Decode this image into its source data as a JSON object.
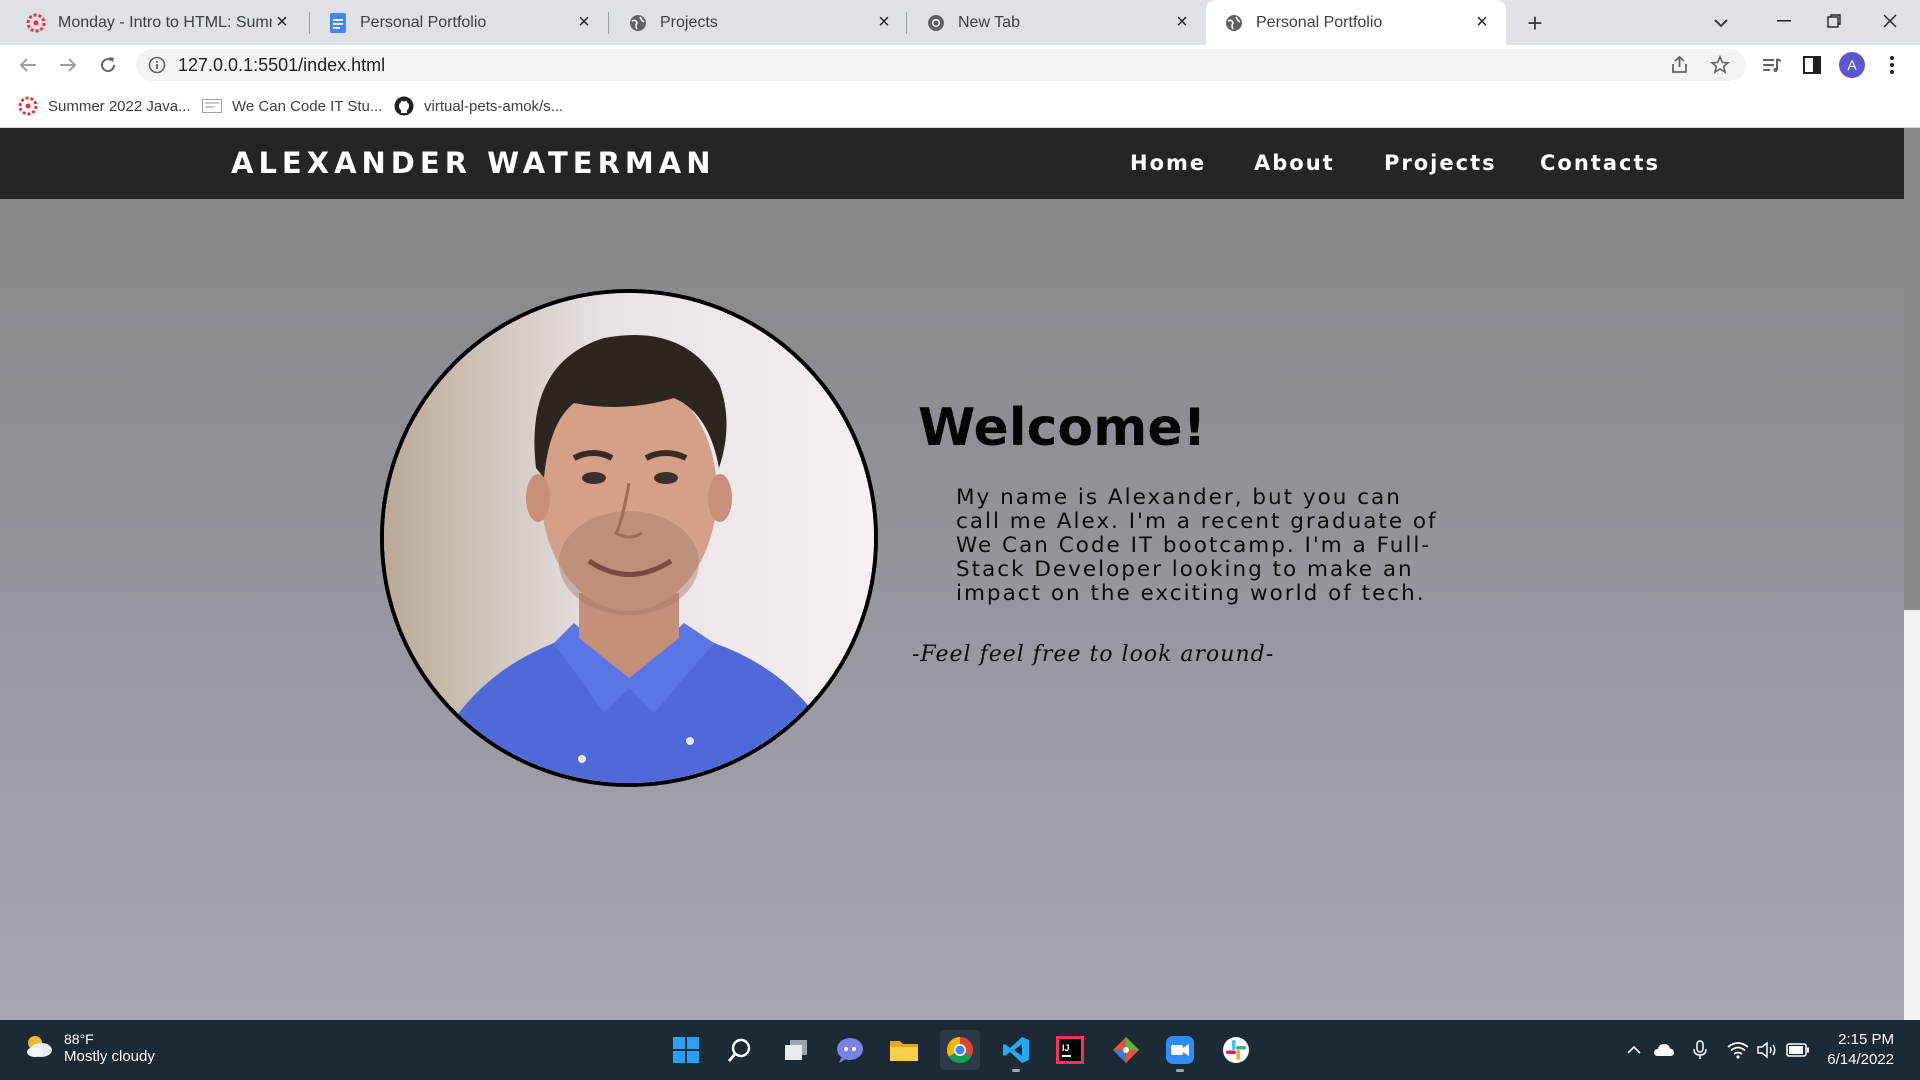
{
  "browser": {
    "tabs": [
      {
        "label": "Monday - Intro to HTML: Summe",
        "icon": "canvas-icon",
        "active": false
      },
      {
        "label": "Personal Portfolio",
        "icon": "google-docs-icon",
        "active": false
      },
      {
        "label": "Projects",
        "icon": "globe-icon",
        "active": false
      },
      {
        "label": "New Tab",
        "icon": "chrome-icon",
        "active": false
      },
      {
        "label": "Personal Portfolio",
        "icon": "globe-icon",
        "active": true
      }
    ],
    "address": "127.0.0.1:5501/index.html",
    "profile_initial": "A",
    "bookmarks": [
      {
        "label": "Summer 2022 Java...",
        "icon": "canvas-icon"
      },
      {
        "label": "We Can Code IT Stu...",
        "icon": "page-icon"
      },
      {
        "label": "virtual-pets-amok/s...",
        "icon": "github-icon"
      }
    ]
  },
  "site": {
    "title": "ALEXANDER WATERMAN",
    "nav": [
      "Home",
      "About",
      "Projects",
      "Contacts"
    ],
    "welcome": "Welcome!",
    "intro": "My name is Alexander, but you can call me Alex. I'm a recent graduate of We Can Code IT bootcamp. I'm a Full-Stack Developer looking to make an impact on the exciting world of tech.",
    "tagline": "-Feel feel free to look around-",
    "portrait": "profile-photo"
  },
  "taskbar": {
    "weather": {
      "temp": "88°F",
      "desc": "Mostly cloudy"
    },
    "apps": [
      "start",
      "search",
      "task-view",
      "teams-chat",
      "file-explorer",
      "chrome",
      "vscode",
      "intellij",
      "git",
      "zoom",
      "slack"
    ],
    "clock": {
      "time": "2:15 PM",
      "date": "6/14/2022"
    }
  },
  "colors": {
    "tabstrip": "#dee1e6",
    "site_header": "#252527",
    "page_top": "#848386",
    "page_bottom": "#a8a6b2",
    "taskbar": "#1c2a36"
  }
}
